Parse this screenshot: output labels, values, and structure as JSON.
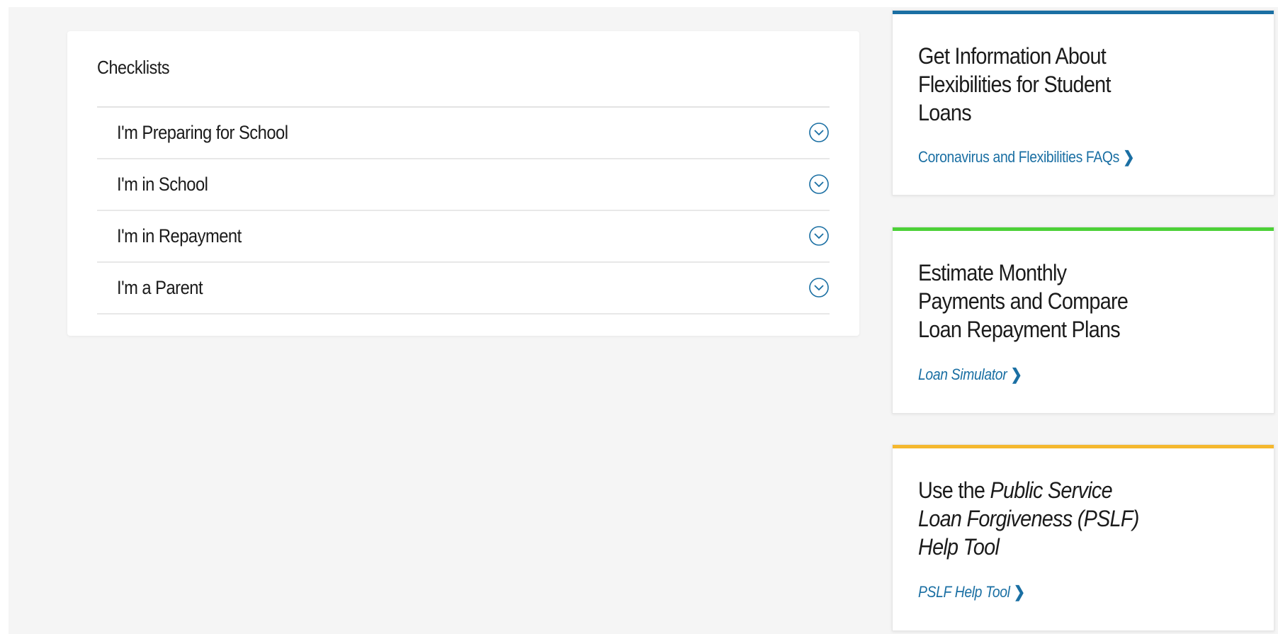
{
  "checklists": {
    "title": "Checklists",
    "items": [
      {
        "label": "I'm Preparing for School"
      },
      {
        "label": "I'm in School"
      },
      {
        "label": "I'm in Repayment"
      },
      {
        "label": "I'm a Parent"
      }
    ]
  },
  "side_cards": [
    {
      "accent_color": "#1a6fa3",
      "heading": "Get Information About Flexibilities for Student Loans",
      "link": "Coronavirus and Flexibilities FAQs"
    },
    {
      "accent_color": "#4cd137",
      "heading": "Estimate Monthly Payments and Compare Loan Repayment Plans",
      "link": "Loan Simulator"
    },
    {
      "accent_color": "#f5b82e",
      "heading_prefix": "Use the",
      "heading_emphasis": "Public Service Loan Forgiveness (PSLF) Help Tool",
      "link": "PSLF Help Tool"
    }
  ],
  "icons": {
    "accordion_toggle": "chevron-down-circle-icon",
    "link_arrow": "chevron-right-icon"
  },
  "colors": {
    "link": "#1a6fa3",
    "background": "#f5f5f5"
  }
}
